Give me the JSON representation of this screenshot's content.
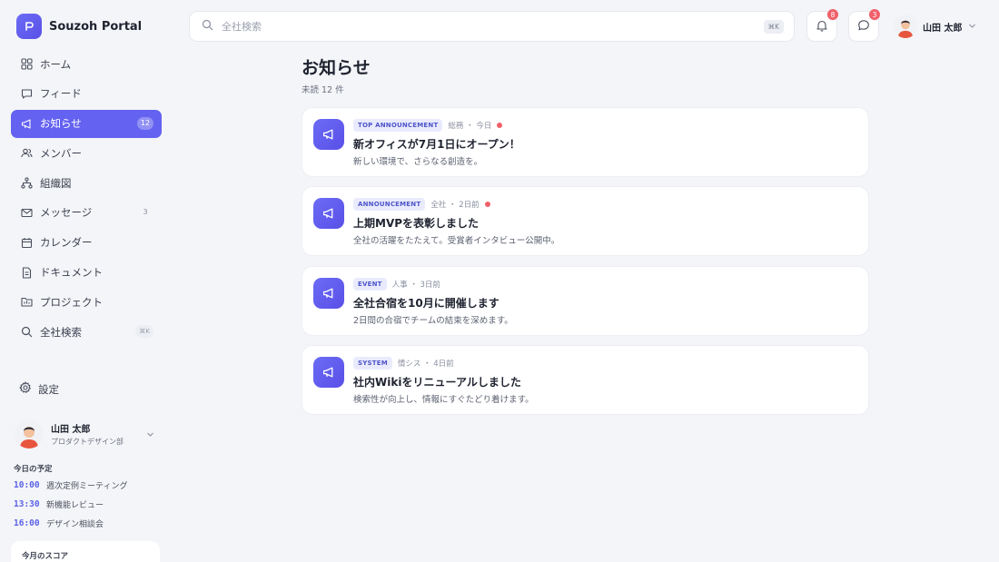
{
  "app": {
    "title": "Souzoh Portal"
  },
  "sidebar": {
    "items": [
      {
        "label": "ホーム",
        "icon": "home-icon"
      },
      {
        "label": "フィード",
        "icon": "feed-icon"
      },
      {
        "label": "お知らせ",
        "icon": "megaphone-icon",
        "badge": "12",
        "active": true
      },
      {
        "label": "メンバー",
        "icon": "users-icon"
      },
      {
        "label": "組織図",
        "icon": "org-chart-icon"
      },
      {
        "label": "メッセージ",
        "icon": "mail-icon",
        "badge": "3"
      },
      {
        "label": "カレンダー",
        "icon": "calendar-icon"
      },
      {
        "label": "ドキュメント",
        "icon": "document-icon"
      },
      {
        "label": "プロジェクト",
        "icon": "folder-icon"
      },
      {
        "label": "全社検索",
        "icon": "search-icon",
        "badge": "⌘K"
      }
    ],
    "settings_label": "設定",
    "user": {
      "name": "山田 太郎",
      "dept": "プロダクトデザイン部"
    },
    "today_title": "今日の予定",
    "schedule": [
      {
        "time": "10:00",
        "event": "週次定例ミーティング"
      },
      {
        "time": "13:30",
        "event": "新機能レビュー"
      },
      {
        "time": "16:00",
        "event": "デザイン相談会"
      }
    ],
    "score_title": "今月のスコア"
  },
  "topbar": {
    "search_placeholder": "全社検索",
    "search_shortcut": "⌘K",
    "notifications_count": "8",
    "messages_count": "3",
    "user_name": "山田 太郎"
  },
  "main": {
    "title": "お知らせ",
    "subtitle": "未読 12 件",
    "announcements": [
      {
        "tag": "TOP ANNOUNCEMENT",
        "meta": "総務 ・ 今日",
        "unread": true,
        "title": "新オフィスが7月1日にオープン！",
        "desc": "新しい環境で、さらなる創造を。"
      },
      {
        "tag": "ANNOUNCEMENT",
        "meta": "全社 ・ 2日前",
        "unread": true,
        "title": "上期MVPを表彰しました",
        "desc": "全社の活躍をたたえて。受賞者インタビュー公開中。"
      },
      {
        "tag": "EVENT",
        "meta": "人事 ・ 3日前",
        "unread": false,
        "title": "全社合宿を10月に開催します",
        "desc": "2日間の合宿でチームの結束を深めます。"
      },
      {
        "tag": "SYSTEM",
        "meta": "情シス ・ 4日前",
        "unread": false,
        "title": "社内Wikiをリニューアルしました",
        "desc": "検索性が向上し、情報にすぐたどり着けます。"
      }
    ]
  },
  "colors": {
    "accent": "#6462f0",
    "unread": "#f0606a"
  }
}
